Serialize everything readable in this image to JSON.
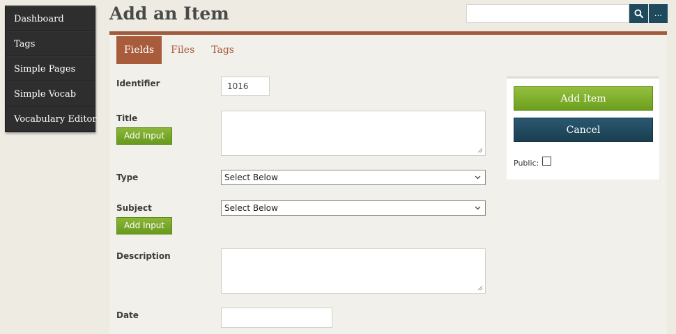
{
  "sidebar": {
    "items": [
      {
        "label": "Dashboard"
      },
      {
        "label": "Tags"
      },
      {
        "label": "Simple Pages"
      },
      {
        "label": "Simple Vocab"
      },
      {
        "label": "Vocabulary Editor"
      }
    ]
  },
  "header": {
    "title": "Add an Item",
    "search": {
      "value": "",
      "placeholder": ""
    },
    "more_label": "..."
  },
  "tabs": [
    {
      "label": "Fields",
      "active": true
    },
    {
      "label": "Files",
      "active": false
    },
    {
      "label": "Tags",
      "active": false
    }
  ],
  "form": {
    "identifier": {
      "label": "Identifier",
      "value": "1016"
    },
    "title": {
      "label": "Title",
      "value": "",
      "add_input_label": "Add Input"
    },
    "type": {
      "label": "Type",
      "selected": "Select Below"
    },
    "subject": {
      "label": "Subject",
      "selected": "Select Below",
      "add_input_label": "Add Input"
    },
    "description": {
      "label": "Description",
      "value": ""
    },
    "date": {
      "label": "Date",
      "value": ""
    }
  },
  "actions": {
    "add_item_label": "Add Item",
    "cancel_label": "Cancel",
    "public_label": "Public:",
    "public_checked": false
  },
  "colors": {
    "accent": "#a85c3c",
    "primary_green": "#7aaa2a",
    "dark_blue": "#1f4a5e",
    "sidebar_bg": "#2b2b2b"
  },
  "icons": {
    "search": "search-icon",
    "select_chevron": "chevron-down-icon",
    "resize": "resize-grip-icon"
  }
}
